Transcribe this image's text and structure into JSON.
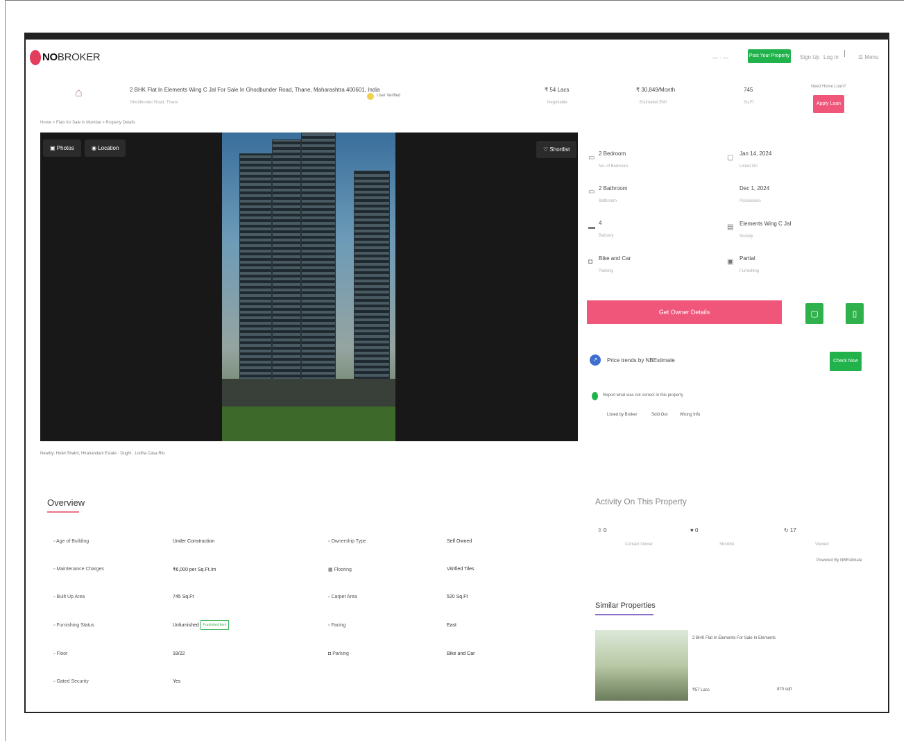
{
  "header": {
    "logo": "NOBROKER",
    "logo_bold": "NO",
    "logo_thin": "BROKER",
    "nav_faint": "— · —",
    "post_property": "Post Your Property",
    "signup": "Sign Up",
    "login": "Log in",
    "menu": "Menu"
  },
  "listing": {
    "title": "2 BHK Flat In Elements Wing C Jal For Sale In Ghodbunder Road, Thane, Maharashtra 400601, India",
    "address": "Ghodbunder Road, Thane",
    "verified": "User Verified",
    "price": "₹ 54 Lacs",
    "price_sub": "Negotiable",
    "emi": "₹ 30,849/Month",
    "emi_sub": "Estimated EMI",
    "area": "745",
    "area_sub": "Sq.Ft",
    "home_loan": "Need Home Loan?",
    "apply_loan": "Apply Loan",
    "breadcrumb": "Home > Flats for Sale in Mumbai > Property Details"
  },
  "photo": {
    "photos_btn": "Photos",
    "location_btn": "Location",
    "shortlist": "Shortlist",
    "nearby": "Nearby: Hotel Shabri, Hiranandani Estate · Dughi · Lodha Casa Rio"
  },
  "details": {
    "bedroom": "2 Bedroom",
    "bedroom_sub": "No. of Bedroom",
    "bathroom": "2 Bathroom",
    "bathroom_sub": "Bathroom",
    "balcony": "4",
    "balcony_sub": "Balcony",
    "parking": "Bike and Car",
    "parking_sub": "Parking",
    "possession": "Jan 14, 2024",
    "possession_sub": "Listed On",
    "available": "Dec 1, 2024",
    "available_sub": "Possession",
    "society": "Elements Wing C Jal",
    "society_sub": "Society",
    "furnishing": "Partial",
    "furnishing_sub": "Furnishing"
  },
  "cta": {
    "get_owner": "Get Owner Details",
    "price_trends": "Price trends by NBEstimate",
    "check_now": "Check Now",
    "report": "Report what was not correct in this property",
    "report_options": [
      "Listed by Broker",
      "Sold Out",
      "Wrong Info"
    ]
  },
  "overview": {
    "title": "Overview",
    "rows": [
      {
        "label": "Age of Building",
        "value": "Under Construction"
      },
      {
        "label": "Maintenance Charges",
        "value": "₹6,000 per Sq.Ft./m"
      },
      {
        "label": "Built Up Area",
        "value": "745 Sq.Ft"
      },
      {
        "label": "Furnishing Status",
        "value": "Unfurnished",
        "badge": "Furnished Item"
      },
      {
        "label": "Floor",
        "value": "18/22"
      },
      {
        "label": "Gated Security",
        "value": "Yes"
      }
    ],
    "rows_right": [
      {
        "label": "Ownership Type",
        "value": "Self Owned"
      },
      {
        "label": "Flooring",
        "value": "Vitrified Tiles"
      },
      {
        "label": "Carpet Area",
        "value": "520 Sq.Ft"
      },
      {
        "label": "Facing",
        "value": "East"
      },
      {
        "label": "Parking",
        "value": "Bike and Car"
      }
    ]
  },
  "activity": {
    "title": "Activity On This Property",
    "stats": [
      {
        "value": "0",
        "label": "Contact Owner"
      },
      {
        "value": "0",
        "label": "Shortlist"
      },
      {
        "value": "17",
        "label": "Viewed"
      }
    ],
    "powered": "Powered By NBEstimate"
  },
  "similar": {
    "title": "Similar Properties",
    "card_title": "2 BHK Flat In Elements For Sale In Elements",
    "card_price": "₹57 Lacs",
    "card_area": "870 sqft"
  },
  "colors": {
    "brand_pink": "#f0557a",
    "brand_green": "#22b24c"
  }
}
